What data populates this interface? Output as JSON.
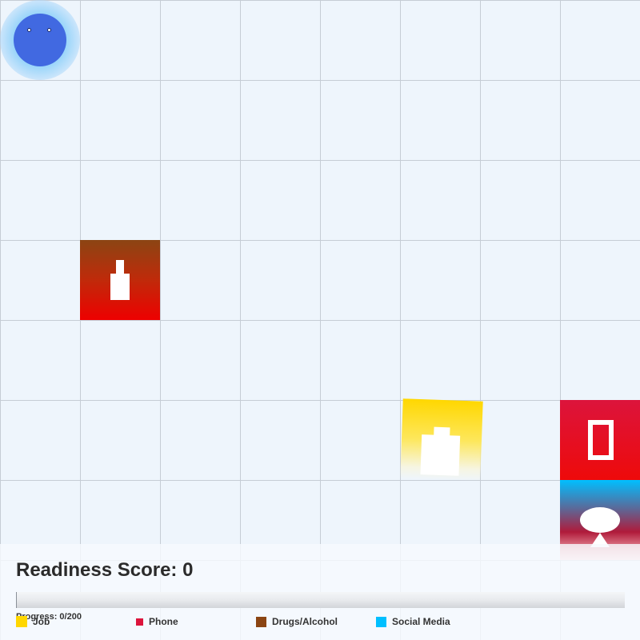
{
  "game": {
    "readiness_label": "Readiness Score:",
    "readiness_score": "0",
    "progress_label": "Progress:",
    "progress_current": 0,
    "progress_max": 200,
    "progress_text": "Progress: 0/200"
  },
  "tiles": [
    {
      "category": "Drugs/Alcohol",
      "icon": "bottle-icon",
      "colors": [
        "#8b4513",
        "#ee0000"
      ]
    },
    {
      "category": "Job",
      "icon": "briefcase-icon",
      "colors": [
        "#ffd700",
        "#ffffff"
      ]
    },
    {
      "category": "Phone",
      "icon": "phone-icon",
      "colors": [
        "#dc143c",
        "#ee0a0a"
      ]
    },
    {
      "category": "Social Media",
      "icon": "speech-bubble-icon",
      "colors": [
        "#00bfff",
        "#ffd0d4"
      ]
    }
  ],
  "player": {
    "color": "#4169e1",
    "glow_color": "#87cefa"
  },
  "legend": [
    {
      "label": "Job",
      "color": "#ffd700"
    },
    {
      "label": "Phone",
      "color": "#dc143c"
    },
    {
      "label": "Drugs/Alcohol",
      "color": "#8b4513"
    },
    {
      "label": "Social Media",
      "color": "#00bfff"
    }
  ],
  "colors": {
    "grid_bg": "#eef5fc",
    "grid_line": "#c5ccd5",
    "progress_fill": "#4caf50"
  }
}
